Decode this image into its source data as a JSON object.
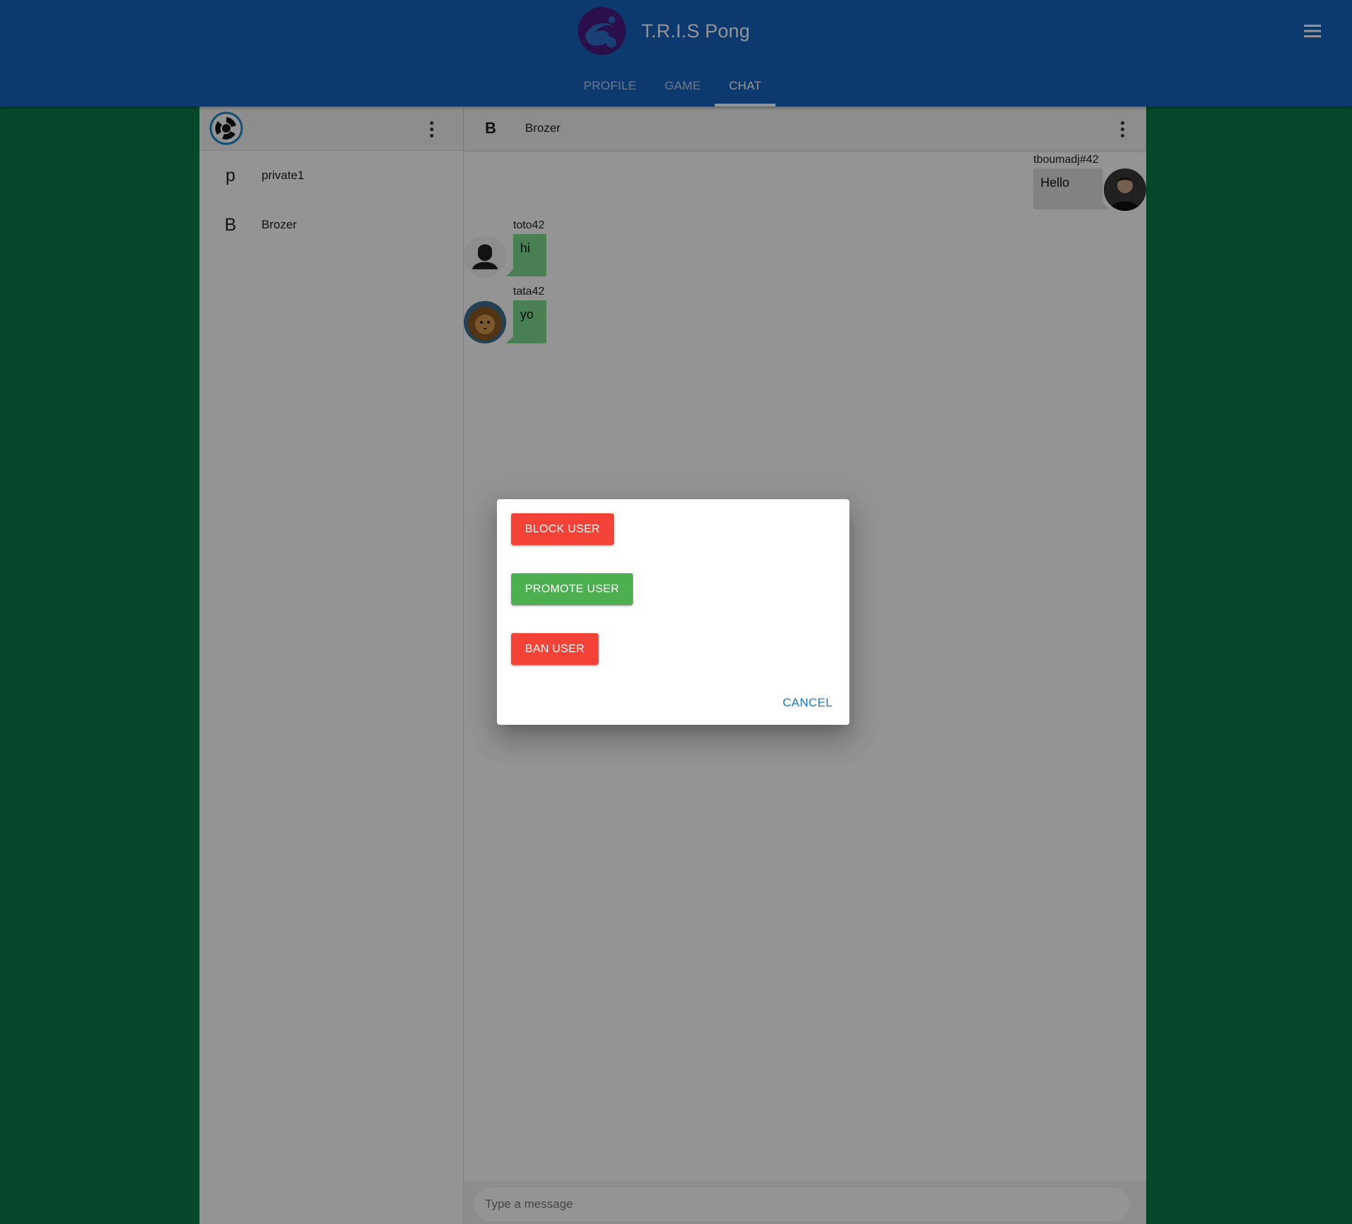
{
  "app": {
    "title": "T.R.I.S Pong"
  },
  "tabs": [
    {
      "label": "PROFILE"
    },
    {
      "label": "GAME"
    },
    {
      "label": "CHAT"
    }
  ],
  "active_tab": "CHAT",
  "sidebar": {
    "conversations": [
      {
        "initial": "p",
        "name": "private1"
      },
      {
        "initial": "B",
        "name": "Brozer"
      }
    ]
  },
  "chat": {
    "header": {
      "initial": "B",
      "name": "Brozer"
    },
    "messages": [
      {
        "user": "tboumadj#42",
        "text": "Hello",
        "mine": true
      },
      {
        "user": "toto42",
        "text": "hi",
        "mine": false
      },
      {
        "user": "tata42",
        "text": "yo",
        "mine": false
      }
    ],
    "composer": {
      "placeholder": "Type a message"
    }
  },
  "dialog": {
    "block_label": "BLOCK USER",
    "promote_label": "PROMOTE USER",
    "ban_label": "BAN USER",
    "cancel_label": "CANCEL"
  },
  "colors": {
    "app_bar": "#1565c0",
    "background": "#0d7a4a",
    "danger": "#f44336",
    "success": "#4caf50",
    "link": "#1976d2"
  }
}
